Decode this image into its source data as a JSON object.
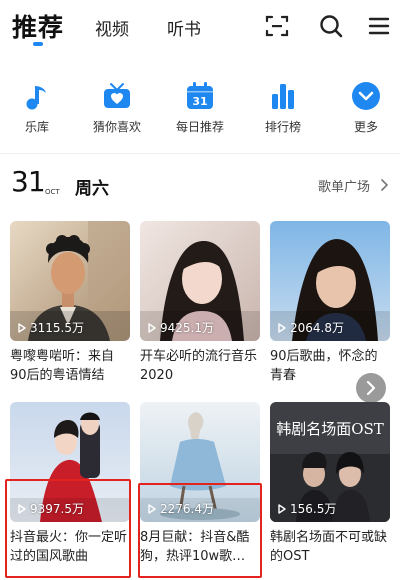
{
  "header": {
    "tabs": [
      {
        "label": "推荐",
        "active": true
      },
      {
        "label": "视频",
        "active": false
      },
      {
        "label": "听书",
        "active": false
      }
    ],
    "icons": [
      "scan-icon",
      "search-icon",
      "menu-icon"
    ],
    "accent_color": "#1e88f0"
  },
  "categories": [
    {
      "label": "乐库",
      "icon": "music-note-icon"
    },
    {
      "label": "猜你喜欢",
      "icon": "heart-radio-icon"
    },
    {
      "label": "每日推荐",
      "icon": "calendar-icon",
      "icon_text": "31"
    },
    {
      "label": "排行榜",
      "icon": "bar-chart-icon"
    },
    {
      "label": "更多",
      "icon": "chevron-down-icon"
    }
  ],
  "date_row": {
    "day": "31",
    "month": "OCT",
    "weekday": "周六",
    "plaza_label": "歌单广场"
  },
  "playlists": [
    {
      "plays": "3115.5万",
      "title": "粤嚟粤啱听：来自90后的粤语情结",
      "highlighted": false
    },
    {
      "plays": "9425.1万",
      "title": "开车必听的流行音乐2020",
      "highlighted": false
    },
    {
      "plays": "2064.8万",
      "title": "90后歌曲，怀念的青春",
      "highlighted": false
    },
    {
      "plays": "9397.5万",
      "title": "抖音最火：你一定听过的国风歌曲",
      "highlighted": true
    },
    {
      "plays": "2276.4万",
      "title": "8月巨献：抖音&酷狗，热评10w歌…",
      "highlighted": true
    },
    {
      "plays": "156.5万",
      "title": "韩剧名场面不可或缺的OST",
      "highlighted": false,
      "cover_text": "韩剧名场面OST"
    }
  ],
  "highlight_color": "#e3231d"
}
